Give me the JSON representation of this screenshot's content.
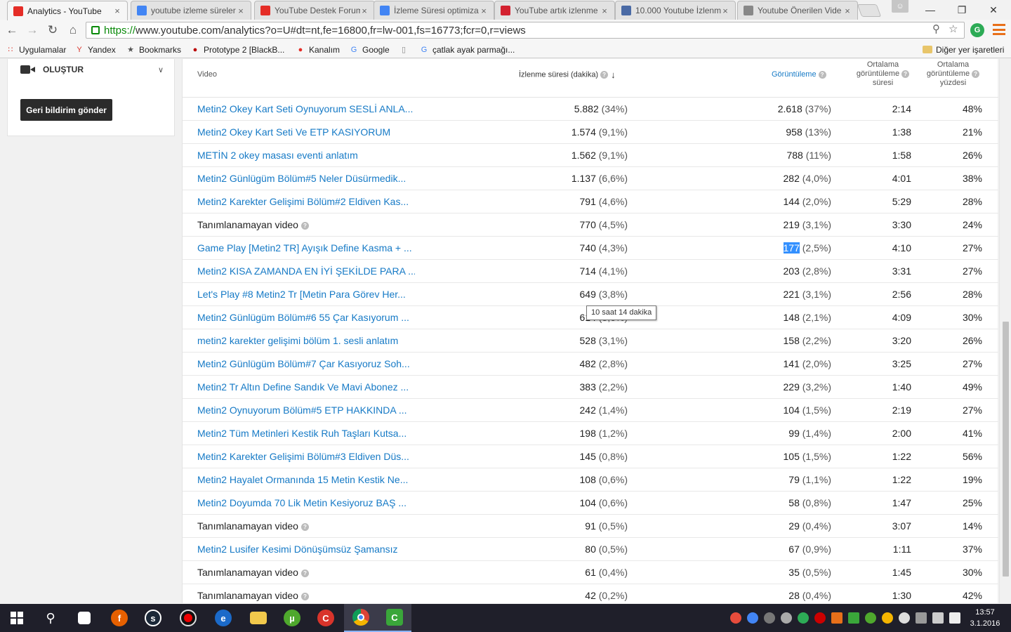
{
  "browser": {
    "tabs": [
      {
        "title": "Analytics - YouTube",
        "favicon": "youtube-icon",
        "color": "#e52d27",
        "active": true
      },
      {
        "title": "youtube izleme süreler",
        "favicon": "google-icon",
        "color": "#4285f4",
        "active": false
      },
      {
        "title": "YouTube Destek Forum",
        "favicon": "youtube-icon",
        "color": "#e52d27",
        "active": false
      },
      {
        "title": "İzleme Süresi optimiza",
        "favicon": "google-icon",
        "color": "#4285f4",
        "active": false
      },
      {
        "title": "YouTube artık izlenme",
        "favicon": "webtekno-icon",
        "color": "#d3212f",
        "active": false
      },
      {
        "title": "10.000 Youtube İzlenm",
        "favicon": "globe-icon",
        "color": "#4a6aa5",
        "active": false
      },
      {
        "title": "Youtube Önerilen Vide",
        "favicon": "page-icon",
        "color": "#888888",
        "active": false
      }
    ],
    "url_scheme": "https://",
    "url_rest": "www.youtube.com/analytics?o=U#dt=nt,fe=16800,fr=lw-001,fs=16773;fcr=0,r=views",
    "bookmarks": [
      {
        "label": "Uygulamalar",
        "icon": "apps-grid-icon"
      },
      {
        "label": "Yandex",
        "icon": "yandex-icon"
      },
      {
        "label": "Bookmarks",
        "icon": "star-icon"
      },
      {
        "label": "Prototype 2 [BlackB...",
        "icon": "prototype-icon"
      },
      {
        "label": "Kanalım",
        "icon": "youtube-icon"
      },
      {
        "label": "Google",
        "icon": "google-icon"
      },
      {
        "label": "",
        "icon": "page-icon"
      },
      {
        "label": "çatlak ayak parmağı...",
        "icon": "google-icon"
      }
    ],
    "other_bookmarks": "Diğer yer işaretleri"
  },
  "sidebar": {
    "create_label": "OLUŞTUR",
    "feedback_button": "Geri bildirim gönder"
  },
  "table": {
    "headers": {
      "video": "Video",
      "watch_time": "İzlenme süresi (dakika)",
      "views": "Görüntüleme",
      "avg_duration": [
        "Ortalama",
        "görüntüleme",
        "süresi"
      ],
      "avg_percent": [
        "Ortalama",
        "görüntüleme",
        "yüzdesi"
      ]
    },
    "rows": [
      {
        "title": "Metin2 Okey Kart Seti Oynuyorum SESLİ ANLA...",
        "link": true,
        "watch": "5.882",
        "watch_pct": "(34%)",
        "views": "2.618",
        "views_pct": "(37%)",
        "dur": "2:14",
        "pct": "48%"
      },
      {
        "title": "Metin2 Okey Kart Seti Ve ETP KASIYORUM",
        "link": true,
        "watch": "1.574",
        "watch_pct": "(9,1%)",
        "views": "958",
        "views_pct": "(13%)",
        "dur": "1:38",
        "pct": "21%"
      },
      {
        "title": "METİN 2 okey masası eventi anlatım",
        "link": true,
        "watch": "1.562",
        "watch_pct": "(9,1%)",
        "views": "788",
        "views_pct": "(11%)",
        "dur": "1:58",
        "pct": "26%"
      },
      {
        "title": "Metin2 Günlügüm Bölüm#5 Neler Düsürmedik...",
        "link": true,
        "watch": "1.137",
        "watch_pct": "(6,6%)",
        "views": "282",
        "views_pct": "(4,0%)",
        "dur": "4:01",
        "pct": "38%"
      },
      {
        "title": "Metin2 Karekter Gelişimi Bölüm#2 Eldiven Kas...",
        "link": true,
        "watch": "791",
        "watch_pct": "(4,6%)",
        "views": "144",
        "views_pct": "(2,0%)",
        "dur": "5:29",
        "pct": "28%"
      },
      {
        "title": "Tanımlanamayan video",
        "link": false,
        "watch": "770",
        "watch_pct": "(4,5%)",
        "views": "219",
        "views_pct": "(3,1%)",
        "dur": "3:30",
        "pct": "24%"
      },
      {
        "title": "Game Play [Metin2 TR] Ayışık Define Kasma + ...",
        "link": true,
        "watch": "740",
        "watch_pct": "(4,3%)",
        "views": "177",
        "views_pct": "(2,5%)",
        "dur": "4:10",
        "pct": "27%",
        "selected": true
      },
      {
        "title": "Metin2 KISA ZAMANDA EN İYİ ŞEKİLDE PARA ...",
        "link": true,
        "watch": "714",
        "watch_pct": "(4,1%)",
        "views": "203",
        "views_pct": "(2,8%)",
        "dur": "3:31",
        "pct": "27%"
      },
      {
        "title": "Let's Play #8 Metin2 Tr [Metin Para Görev Her...",
        "link": true,
        "watch": "649",
        "watch_pct": "(3,8%)",
        "views": "221",
        "views_pct": "(3,1%)",
        "dur": "2:56",
        "pct": "28%"
      },
      {
        "title": "Metin2 Günlügüm Bölüm#6 55 Çar Kasıyorum ...",
        "link": true,
        "watch": "614",
        "watch_pct": "(3,6%)",
        "views": "148",
        "views_pct": "(2,1%)",
        "dur": "4:09",
        "pct": "30%"
      },
      {
        "title": "metin2 karekter gelişimi bölüm 1. sesli anlatım",
        "link": true,
        "watch": "528",
        "watch_pct": "(3,1%)",
        "views": "158",
        "views_pct": "(2,2%)",
        "dur": "3:20",
        "pct": "26%"
      },
      {
        "title": "Metin2 Günlügüm Bölüm#7 Çar Kasıyoruz Soh...",
        "link": true,
        "watch": "482",
        "watch_pct": "(2,8%)",
        "views": "141",
        "views_pct": "(2,0%)",
        "dur": "3:25",
        "pct": "27%"
      },
      {
        "title": "Metin2 Tr Altın Define Sandık Ve Mavi Abonez ...",
        "link": true,
        "watch": "383",
        "watch_pct": "(2,2%)",
        "views": "229",
        "views_pct": "(3,2%)",
        "dur": "1:40",
        "pct": "49%"
      },
      {
        "title": "Metin2 Oynuyorum Bölüm#5 ETP HAKKINDA ...",
        "link": true,
        "watch": "242",
        "watch_pct": "(1,4%)",
        "views": "104",
        "views_pct": "(1,5%)",
        "dur": "2:19",
        "pct": "27%"
      },
      {
        "title": "Metin2 Tüm Metinleri Kestik Ruh Taşları Kutsa...",
        "link": true,
        "watch": "198",
        "watch_pct": "(1,2%)",
        "views": "99",
        "views_pct": "(1,4%)",
        "dur": "2:00",
        "pct": "41%"
      },
      {
        "title": "Metin2 Karekter Gelişimi Bölüm#3 Eldiven Düs...",
        "link": true,
        "watch": "145",
        "watch_pct": "(0,8%)",
        "views": "105",
        "views_pct": "(1,5%)",
        "dur": "1:22",
        "pct": "56%"
      },
      {
        "title": "Metin2 Hayalet Ormanında 15 Metin Kestik Ne...",
        "link": true,
        "watch": "108",
        "watch_pct": "(0,6%)",
        "views": "79",
        "views_pct": "(1,1%)",
        "dur": "1:22",
        "pct": "19%"
      },
      {
        "title": "Metin2 Doyumda 70 Lik Metin Kesiyoruz BAŞ ...",
        "link": true,
        "watch": "104",
        "watch_pct": "(0,6%)",
        "views": "58",
        "views_pct": "(0,8%)",
        "dur": "1:47",
        "pct": "25%"
      },
      {
        "title": "Tanımlanamayan video",
        "link": false,
        "watch": "91",
        "watch_pct": "(0,5%)",
        "views": "29",
        "views_pct": "(0,4%)",
        "dur": "3:07",
        "pct": "14%"
      },
      {
        "title": "Metin2 Lusifer Kesimi Dönüşümsüz Şamansız",
        "link": true,
        "watch": "80",
        "watch_pct": "(0,5%)",
        "views": "67",
        "views_pct": "(0,9%)",
        "dur": "1:11",
        "pct": "37%"
      },
      {
        "title": "Tanımlanamayan video",
        "link": false,
        "watch": "61",
        "watch_pct": "(0,4%)",
        "views": "35",
        "views_pct": "(0,5%)",
        "dur": "1:45",
        "pct": "30%"
      },
      {
        "title": "Tanımlanamayan video",
        "link": false,
        "watch": "42",
        "watch_pct": "(0,2%)",
        "views": "28",
        "views_pct": "(0,4%)",
        "dur": "1:30",
        "pct": "42%"
      }
    ],
    "tooltip": "10 saat 14 dakika"
  },
  "taskbar": {
    "time": "13:57",
    "date": "3.1.2016"
  },
  "colors": {
    "link": "#167ac6",
    "youtube_red": "#e52d27",
    "selection": "#3390ff"
  }
}
